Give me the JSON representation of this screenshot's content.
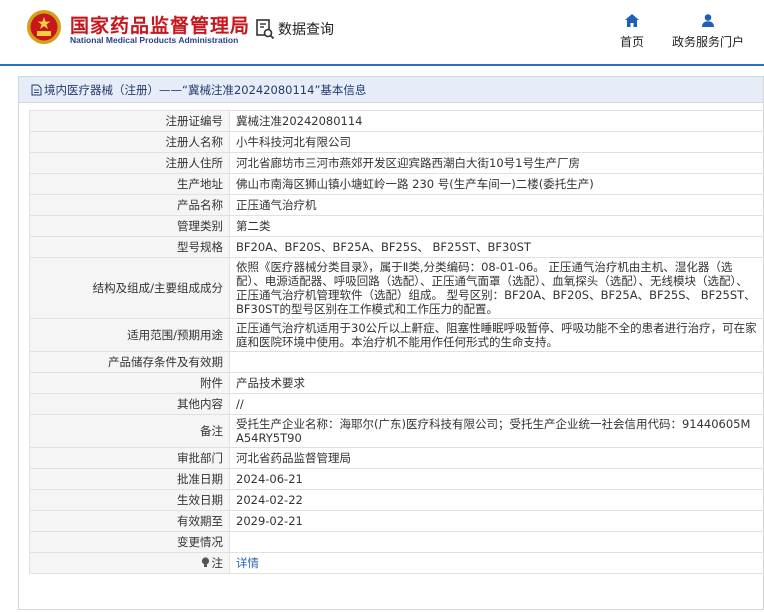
{
  "header": {
    "site_title": "国家药品监督管理局",
    "site_subtitle": "National Medical Products Administration",
    "data_query_label": "数据查询",
    "nav": {
      "home": "首页",
      "portal": "政务服务门户"
    },
    "colors": {
      "brand_red": "#c8161d",
      "accent_blue": "#2d6ec8"
    }
  },
  "panel": {
    "title": "境内医疗器械（注册）——“冀械注准20242080114”基本信息"
  },
  "rows": [
    {
      "key": "注册证编号",
      "value": "冀械注准20242080114"
    },
    {
      "key": "注册人名称",
      "value": "小牛科技河北有限公司"
    },
    {
      "key": "注册人住所",
      "value": "河北省廊坊市三河市燕郊开发区迎宾路西潮白大街10号1号生产厂房"
    },
    {
      "key": "生产地址",
      "value": "佛山市南海区狮山镇小塘虹岭一路 230 号(生产车间一)二楼(委托生产)"
    },
    {
      "key": "产品名称",
      "value": "正压通气治疗机"
    },
    {
      "key": "管理类别",
      "value": "第二类"
    },
    {
      "key": "型号规格",
      "value": "BF20A、BF20S、BF25A、BF25S、 BF25ST、BF30ST"
    },
    {
      "key": "结构及组成/主要组成成分",
      "value": "依照《医疗器械分类目录》，属于Ⅱ类,分类编码：08-01-06。 正压通气治疗机由主机、湿化器（选配）、电源适配器、呼吸回路（选配）、正压通气面罩（选配）、血氧探头（选配）、无线模块（选配）、正压通气治疗机管理软件（选配）组成。 型号区别：BF20A、BF20S、BF25A、BF25S、 BF25ST、BF30ST的型号区别在工作模式和工作压力的配置。"
    },
    {
      "key": "适用范围/预期用途",
      "value": "正压通气治疗机适用于30公斤以上鼾症、阻塞性睡眠呼吸暂停、呼吸功能不全的患者进行治疗，可在家庭和医院环境中使用。本治疗机不能用作任何形式的生命支持。"
    },
    {
      "key": "产品储存条件及有效期",
      "value": ""
    },
    {
      "key": "附件",
      "value": "产品技术要求"
    },
    {
      "key": "其他内容",
      "value": "//"
    },
    {
      "key": "备注",
      "value": "受托生产企业名称：海耶尔(广东)医疗科技有限公司；受托生产企业统一社会信用代码：91440605MA54RY5T90"
    },
    {
      "key": "审批部门",
      "value": "河北省药品监督管理局"
    },
    {
      "key": "批准日期",
      "value": "2024-06-21"
    },
    {
      "key": "生效日期",
      "value": "2024-02-22"
    },
    {
      "key": "有效期至",
      "value": "2029-02-21"
    },
    {
      "key": "变更情况",
      "value": ""
    }
  ],
  "note_row": {
    "key": "注",
    "link": "详情",
    "icon": "lightbulb-icon"
  }
}
